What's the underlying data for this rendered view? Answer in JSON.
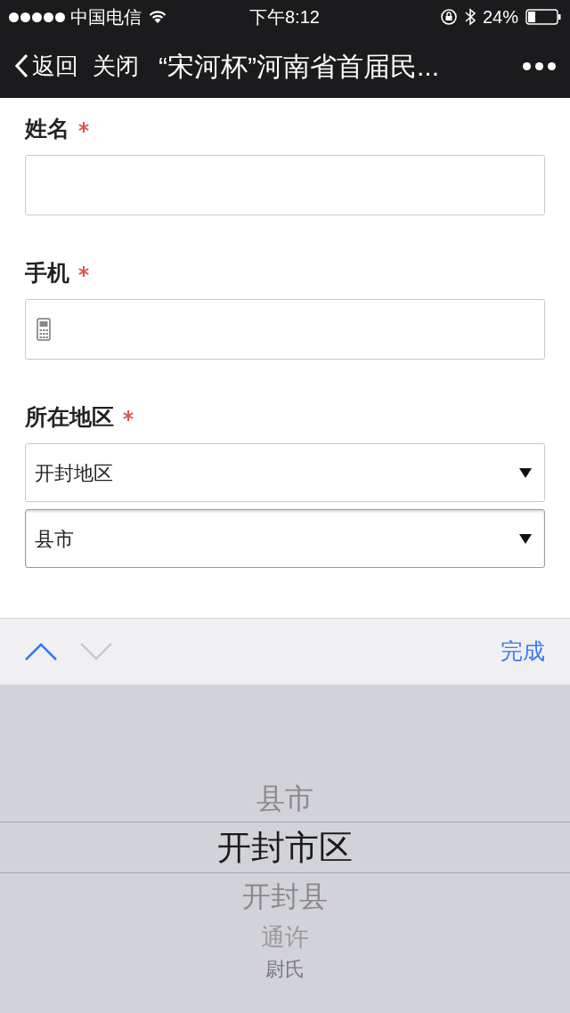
{
  "status_bar": {
    "carrier": "中国电信",
    "time": "下午8:12",
    "battery": "24%"
  },
  "nav": {
    "back": "返回",
    "close": "关闭",
    "title": "“宋河杯”河南省首届民..."
  },
  "form": {
    "sections": [
      {
        "label": "姓名",
        "required": true,
        "fields": [
          {
            "kind": "text"
          }
        ]
      },
      {
        "label": "手机",
        "required": true,
        "fields": [
          {
            "kind": "phone"
          }
        ]
      },
      {
        "label": "所在地区",
        "required": true,
        "fields": [
          {
            "kind": "select",
            "value": "开封地区",
            "focused": false
          },
          {
            "kind": "select",
            "value": "县市",
            "focused": true
          }
        ]
      }
    ]
  },
  "toolbar": {
    "prev_disabled": false,
    "next_disabled": true,
    "done": "完成"
  },
  "picker": {
    "items": [
      {
        "label": "县市",
        "selected": false
      },
      {
        "label": "开封市区",
        "selected": true
      },
      {
        "label": "开封县",
        "selected": false
      },
      {
        "label": "通许",
        "selected": false
      },
      {
        "label": "尉氏",
        "selected": false
      }
    ]
  }
}
